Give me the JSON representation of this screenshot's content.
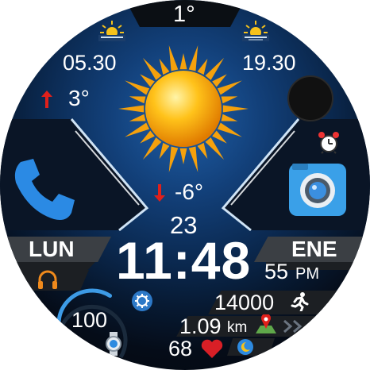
{
  "weather": {
    "current_temp": "1°",
    "sunrise_time": "05.30",
    "sunset_time": "19.30",
    "high_temp": "3°",
    "low_temp": "-6°"
  },
  "date": {
    "day_number": "23",
    "weekday": "LUN",
    "month": "ENE"
  },
  "time": {
    "hours_minutes": "11:48",
    "seconds": "55",
    "ampm": "PM"
  },
  "stats": {
    "steps": "14000",
    "distance_value": "1.09",
    "distance_unit": "km",
    "heart_rate": "68",
    "battery": "100",
    "battery_level": 0.62
  },
  "icons": {
    "sunrise": "sunrise-icon",
    "sunset": "sunset-icon",
    "weather": "sun-icon",
    "phone": "phone-icon",
    "camera": "camera-icon",
    "alarm": "alarm-clock-icon",
    "music": "headphones-icon",
    "settings": "gear-icon",
    "steps": "running-icon",
    "map": "map-pin-icon",
    "heart": "heart-icon",
    "sleep": "moon-icon",
    "watch": "watch-icon"
  },
  "colors": {
    "accent_blue": "#2d8ae0",
    "arrow_red": "#e0201b",
    "heart_red": "#d81f26",
    "orange": "#f08a1c"
  }
}
